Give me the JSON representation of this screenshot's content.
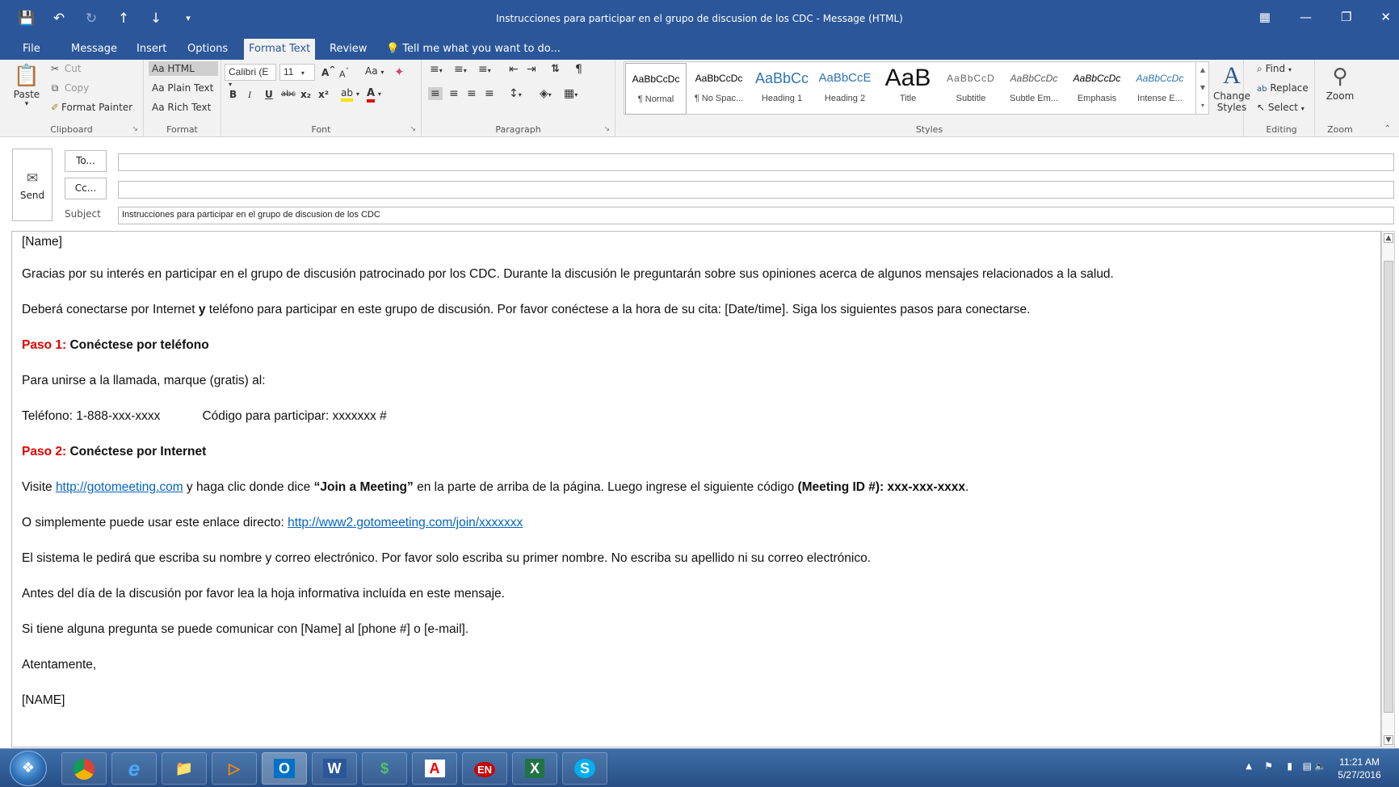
{
  "window": {
    "title": "Instrucciones para participar en el grupo de discusion de los CDC - Message (HTML)",
    "qat": [
      "save-icon",
      "undo-icon",
      "redo-icon",
      "up-icon",
      "down-icon",
      "customize-icon"
    ],
    "controls": [
      "ribbon-display-icon",
      "minimize-icon",
      "restore-icon",
      "close-icon"
    ]
  },
  "menu": {
    "tabs": [
      "File",
      "Message",
      "Insert",
      "Options",
      "Format Text",
      "Review"
    ],
    "active": "Format Text",
    "tell_me": "Tell me what you want to do..."
  },
  "ribbon": {
    "clipboard": {
      "label": "Clipboard",
      "paste": "Paste",
      "cut": "Cut",
      "copy": "Copy",
      "format_painter": "Format Painter"
    },
    "format": {
      "label": "Format",
      "html": "Aa HTML",
      "plain": "Aa Plain Text",
      "rich": "Aa Rich Text"
    },
    "font": {
      "label": "Font",
      "family": "Calibri (E",
      "size": "11",
      "bold": "B",
      "italic": "I",
      "underline": "U",
      "strike": "abc",
      "sub": "x₂",
      "sup": "x²",
      "case": "Aa",
      "grow": "A",
      "shrink": "A"
    },
    "paragraph": {
      "label": "Paragraph"
    },
    "styles": {
      "label": "Styles",
      "items": [
        {
          "sample": "AaBbCcDc",
          "name": "¶ Normal"
        },
        {
          "sample": "AaBbCcDc",
          "name": "¶ No Spac..."
        },
        {
          "sample": "AaBbCc",
          "name": "Heading 1"
        },
        {
          "sample": "AaBbCcE",
          "name": "Heading 2"
        },
        {
          "sample": "AaB",
          "name": "Title"
        },
        {
          "sample": "AaBbCcD",
          "name": "Subtitle"
        },
        {
          "sample": "AaBbCcDc",
          "name": "Subtle Em..."
        },
        {
          "sample": "AaBbCcDc",
          "name": "Emphasis"
        },
        {
          "sample": "AaBbCcDc",
          "name": "Intense E..."
        }
      ],
      "change_styles": "Change Styles"
    },
    "editing": {
      "label": "Editing",
      "find": "Find",
      "replace": "Replace",
      "select": "Select"
    },
    "zoom": {
      "label": "Zoom",
      "button": "Zoom"
    }
  },
  "compose": {
    "send": "Send",
    "to_button": "To...",
    "cc_button": "Cc...",
    "subject_label": "Subject",
    "to_value": "",
    "cc_value": "",
    "subject_value": "Instrucciones para participar en el grupo de discusion de los CDC"
  },
  "body": {
    "greeting": "[Name]",
    "p1": "Gracias por su interés en participar en el grupo de discusión patrocinado por los CDC. Durante la discusión le preguntarán sobre sus opiniones acerca de algunos mensajes relacionados a la salud.",
    "p2_a": "Deberá conectarse por Internet ",
    "p2_b": "y",
    "p2_c": " teléfono para participar en este grupo de discusión. Por favor conéctese a la hora de su cita: [Date/time]. Siga los siguientes pasos para conectarse.",
    "step1_label": "Paso 1:",
    "step1_title": "Conéctese por teléfono",
    "p3": "Para unirse a la llamada, marque (gratis) al:",
    "phone": "Teléfono: 1-888-xxx-xxxx",
    "code": "Código para participar: xxxxxxx #",
    "step2_label": "Paso 2:",
    "step2_title": "Conéctese por Internet",
    "p4_a": "Visite ",
    "p4_link": "http://gotomeeting.com",
    "p4_b": " y haga clic donde dice ",
    "p4_join": "“Join a Meeting”",
    "p4_c": " en la parte de arriba de la página. Luego ingrese el siguiente código ",
    "p4_id": "(Meeting ID #): xxx-xxx-xxxx",
    "p4_d": ".",
    "p5_a": "O simplemente puede usar este enlace directo: ",
    "p5_link": "http://www2.gotomeeting.com/join/xxxxxxx",
    "p6": "El sistema le pedirá que escriba su nombre y correo electrónico. Por favor solo escriba su primer nombre. No escriba su apellido ni su correo electrónico.",
    "p7": "Antes del día de la discusión por favor lea la hoja informativa incluída en este mensaje.",
    "p8": "Si tiene alguna pregunta se puede comunicar con [Name] al [phone #] o [e-mail].",
    "closing": "Atentamente,",
    "signature": "[NAME]"
  },
  "taskbar": {
    "apps": [
      "chrome-icon",
      "internet-explorer-icon",
      "file-explorer-icon",
      "media-player-icon",
      "outlook-icon",
      "word-icon",
      "app-s-icon",
      "acrobat-icon",
      "app-en-icon",
      "excel-icon",
      "skype-icon"
    ],
    "app_letters": {
      "outlook": "O",
      "word": "W",
      "excel": "X",
      "skype": "S",
      "acrobat": "A",
      "en": "EN"
    },
    "time": "11:21 AM",
    "date": "5/27/2016"
  },
  "colors": {
    "accent": "#2b579a",
    "link": "#0563c1",
    "step_red": "#e00000"
  }
}
